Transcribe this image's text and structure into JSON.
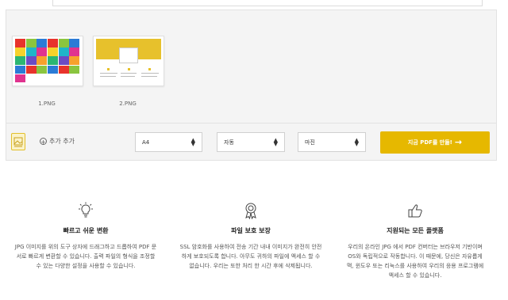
{
  "files": [
    {
      "name": "1.PNG"
    },
    {
      "name": "2.PNG"
    }
  ],
  "toolbar": {
    "add_more_label": "추가 추가",
    "page_size": "A4",
    "orientation": "자동",
    "margin": "마진",
    "convert_label": "지금 PDF를 만듦!"
  },
  "features": [
    {
      "icon": "lightbulb-icon",
      "title": "빠르고 쉬운 변환",
      "desc": "JPG 이미지를 위의 도구 상자에 드래그하고 드롭하여 PDF 문서로 빠르게 변환할 수 있습니다. 출력 파일의 형식을 조정할 수 있는 다양한 설정을 사용할 수 있습니다."
    },
    {
      "icon": "award-ribbon-icon",
      "title": "파일 보호 보장",
      "desc": "SSL 암호화를 사용하여 전송 기간 내내 이미지가 완전히 안전하게 보호되도록 합니다. 아무도 귀하의 파일에 액세스 할 수 없습니다. 우리는 또한 처리 한 시간 후에 삭제됩니다."
    },
    {
      "icon": "thumbs-up-icon",
      "title": "지원되는 모든 플랫폼",
      "desc": "우리의 온라인 JPG 에서 PDF 컨버터는 브라우저 기반이며 OS와 독립적으로 작동합니다. 이 때문에, 당신은 자유롭게 맥, 윈도우 또는 리눅스를 사용하여 우리의 응용 프로그램에 액세스 할 수 있습니다."
    }
  ],
  "colors": {
    "accent": "#e6b800",
    "panel_bg": "#f4f4f4"
  }
}
